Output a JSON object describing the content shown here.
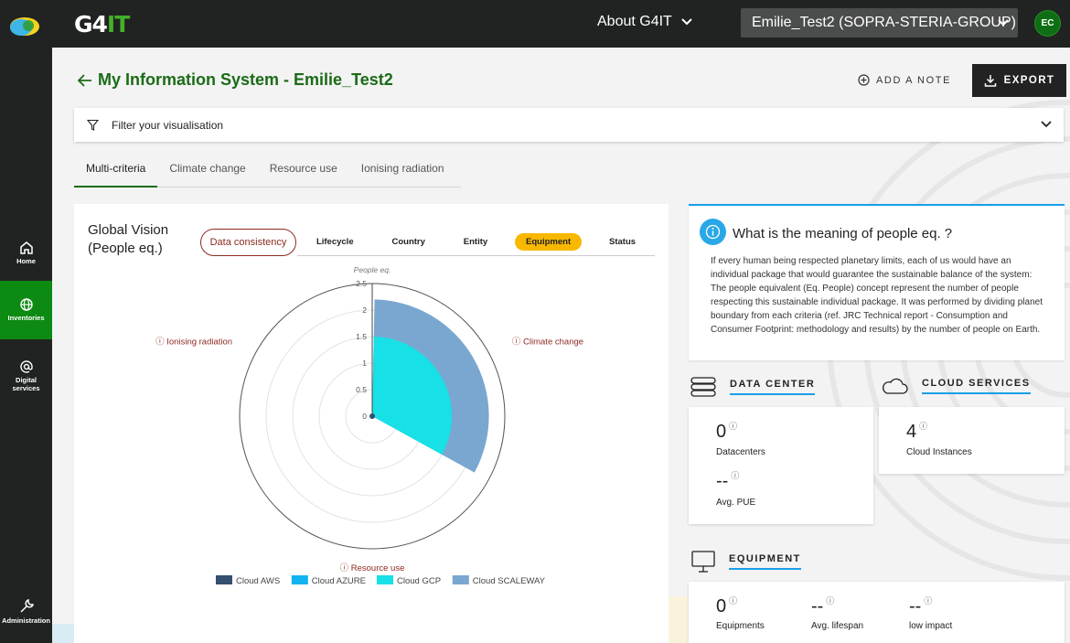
{
  "topbar": {
    "brand_g4": "G4",
    "brand_it": "IT",
    "about_label": "About G4IT",
    "org_selected": "Emilie_Test2 (SOPRA-STERIA-GROUP)",
    "avatar_initials": "EC"
  },
  "sidebar": {
    "items": [
      {
        "label": "Home",
        "icon": "home-icon"
      },
      {
        "label": "Inventories",
        "icon": "globe-icon"
      },
      {
        "label": "Digital services",
        "icon": "at-icon"
      },
      {
        "label": "Administration",
        "icon": "wrench-icon"
      }
    ]
  },
  "header": {
    "title": "My Information System - Emilie_Test2",
    "add_note_label": "ADD A NOTE",
    "export_label": "EXPORT"
  },
  "filter": {
    "label": "Filter your visualisation"
  },
  "tabs": [
    {
      "label": "Multi-criteria",
      "active": true
    },
    {
      "label": "Climate change",
      "active": false
    },
    {
      "label": "Resource use",
      "active": false
    },
    {
      "label": "Ionising radiation",
      "active": false
    }
  ],
  "chart_card": {
    "title_line1": "Global Vision",
    "title_line2": "(People eq.)",
    "data_consistency_label": "Data consistency",
    "segments": [
      {
        "label": "Lifecycle",
        "active": false
      },
      {
        "label": "Country",
        "active": false
      },
      {
        "label": "Entity",
        "active": false
      },
      {
        "label": "Equipment",
        "active": true
      },
      {
        "label": "Status",
        "active": false
      }
    ]
  },
  "chart_data": {
    "type": "polar-bar",
    "title": "",
    "radial_axis_label": "People eq.",
    "radial_ticks": [
      "0",
      "0.5",
      "1",
      "1.5",
      "2",
      "2.5"
    ],
    "rlim": [
      0,
      2.5
    ],
    "categories": [
      "Climate change",
      "Resource use",
      "Ionising radiation"
    ],
    "series": [
      {
        "name": "Cloud AWS",
        "color": "#34506e",
        "values": [
          0.05,
          0,
          0
        ]
      },
      {
        "name": "Cloud AZURE",
        "color": "#12b4f0",
        "values": [
          0,
          0,
          0
        ]
      },
      {
        "name": "Cloud GCP",
        "color": "#17e0e6",
        "values": [
          1.5,
          0,
          0
        ]
      },
      {
        "name": "Cloud SCALEWAY",
        "color": "#7aa7d0",
        "values": [
          2.2,
          0,
          0
        ]
      }
    ],
    "legend_position": "bottom"
  },
  "info": {
    "title": "What is the meaning of people eq. ?",
    "text": "If every human being respected planetary limits, each of us would have an individual package that would guarantee the sustainable balance of the system: The people equivalent (Eq. People) concept represent the number of people respecting this sustainable individual package. It was performed by dividing planet boundary from each criteria (ref. JRC Technical report - Consumption and Consumer Footprint: methodology and results) by the number of people on Earth."
  },
  "data_center": {
    "heading": "DATA CENTER",
    "count": "0",
    "count_label": "Datacenters",
    "pue": "--",
    "pue_label": "Avg. PUE"
  },
  "cloud_services": {
    "heading": "CLOUD SERVICES",
    "count": "4",
    "count_label": "Cloud Instances"
  },
  "equipment": {
    "heading": "EQUIPMENT",
    "equipments": "0",
    "equipments_label": "Equipments",
    "lifespan": "--",
    "lifespan_label": "Avg. lifespan",
    "low_impact": "--",
    "low_impact_label": "low impact"
  },
  "colors": {
    "topbar": "#202321",
    "accent_green": "#1b6b17",
    "active_nav": "#0d8a12",
    "accent_blue": "#1a9fe8",
    "segment_active": "#f8b800",
    "consistency": "#8b2a20"
  }
}
